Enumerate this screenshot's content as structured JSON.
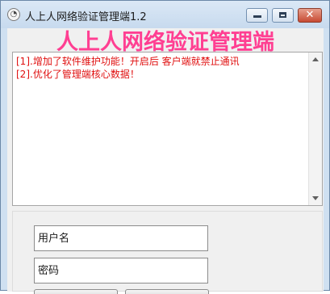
{
  "window": {
    "title": "人上人网络验证管理端1.2",
    "icon": "app-logo-icon",
    "controls": {
      "minimize": "minimize-icon",
      "maximize": "maximize-icon",
      "close": "close-icon"
    }
  },
  "banner": {
    "text": "人上人网络验证管理端",
    "color": "#ff3f92"
  },
  "log": {
    "lines": [
      "[1].增加了软件维护功能！开启后 客户端就禁止通讯",
      "[2].优化了管理端核心数据！"
    ],
    "text_color": "#e01010"
  },
  "login": {
    "username_placeholder": "用户名",
    "password_placeholder": "密码"
  }
}
